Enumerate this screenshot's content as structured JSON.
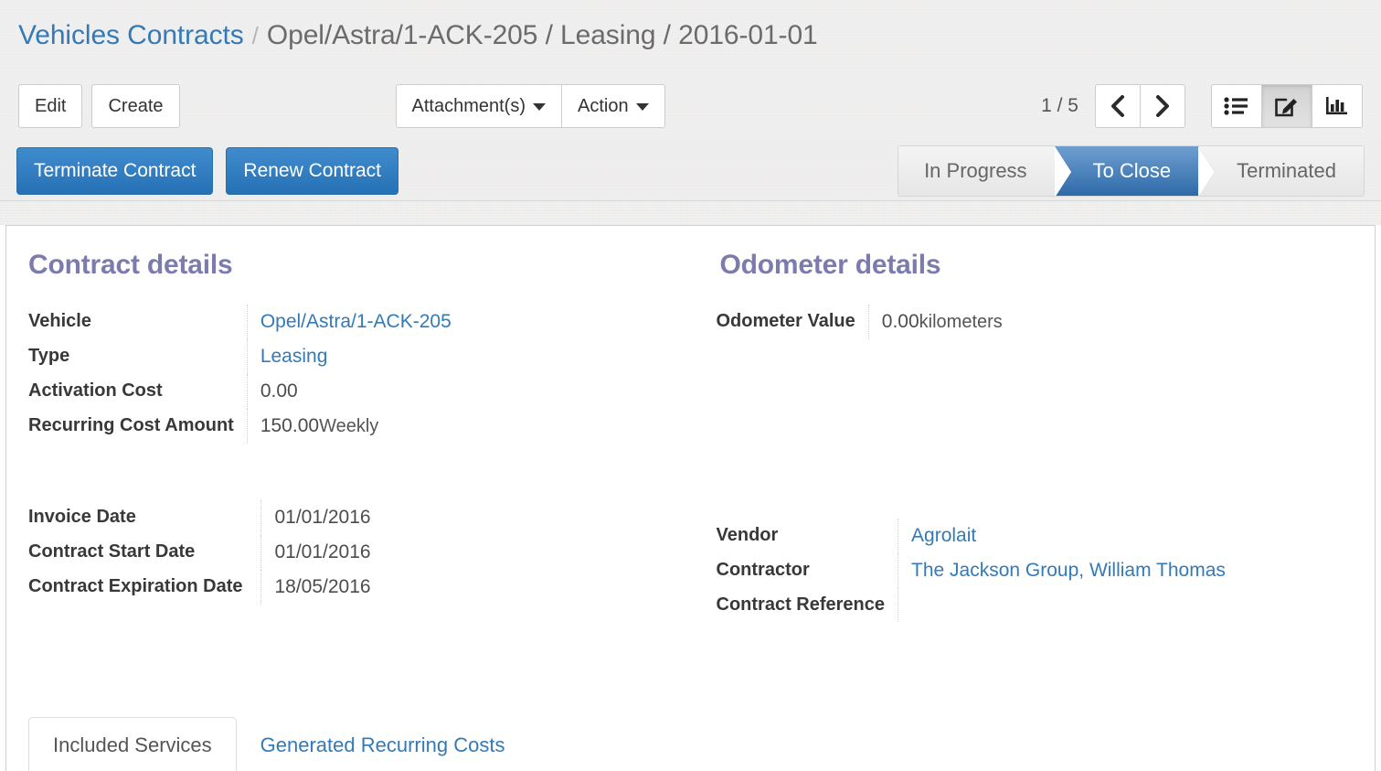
{
  "breadcrumb": {
    "root": "Vehicles Contracts",
    "separator": "/",
    "current": "Opel/Astra/1-ACK-205 / Leasing / 2016-01-01"
  },
  "toolbar": {
    "edit_label": "Edit",
    "create_label": "Create",
    "attachments_label": "Attachment(s)",
    "action_label": "Action",
    "pager": "1 / 5",
    "prev_icon": "chevron-left-icon",
    "next_icon": "chevron-right-icon",
    "views": [
      {
        "name": "list-view",
        "icon": "list-icon",
        "active": false
      },
      {
        "name": "form-view",
        "icon": "edit-pencil-icon",
        "active": true
      },
      {
        "name": "graph-view",
        "icon": "bar-chart-icon",
        "active": false
      }
    ]
  },
  "statusbar": {
    "buttons": [
      {
        "label": "Terminate Contract"
      },
      {
        "label": "Renew Contract"
      }
    ],
    "stages": [
      {
        "label": "In Progress",
        "active": false
      },
      {
        "label": "To Close",
        "active": true
      },
      {
        "label": "Terminated",
        "active": false
      }
    ]
  },
  "form": {
    "contract_details": {
      "title": "Contract details",
      "fields": [
        {
          "label": "Vehicle",
          "value": "Opel/Astra/1-ACK-205",
          "link": true
        },
        {
          "label": "Type",
          "value": "Leasing",
          "link": true
        },
        {
          "label": "Activation Cost",
          "value": "0.00",
          "link": false
        },
        {
          "label": "Recurring Cost Amount",
          "value": "150.00",
          "unit": "Weekly",
          "link": false
        }
      ]
    },
    "odometer_details": {
      "title": "Odometer details",
      "fields": [
        {
          "label": "Odometer Value",
          "value": "0.00",
          "unit": "kilometers",
          "link": false
        }
      ]
    },
    "dates": {
      "fields": [
        {
          "label": "Invoice Date",
          "value": "01/01/2016"
        },
        {
          "label": "Contract Start Date",
          "value": "01/01/2016"
        },
        {
          "label": "Contract Expiration Date",
          "value": "18/05/2016"
        }
      ]
    },
    "vendor_group": {
      "fields": [
        {
          "label": "Vendor",
          "value": "Agrolait",
          "link": true
        },
        {
          "label": "Contractor",
          "value": "The Jackson Group, William Thomas",
          "link": true
        },
        {
          "label": "Contract Reference",
          "value": "",
          "link": false
        }
      ]
    }
  },
  "notebook": {
    "tabs": [
      {
        "label": "Included Services",
        "active": true
      },
      {
        "label": "Generated Recurring Costs",
        "active": false
      }
    ]
  },
  "colors": {
    "link": "#337ab7",
    "group_title": "#7c7bad",
    "primary_button": "#2e7ec4",
    "active_stage": "#2e6aa8"
  }
}
